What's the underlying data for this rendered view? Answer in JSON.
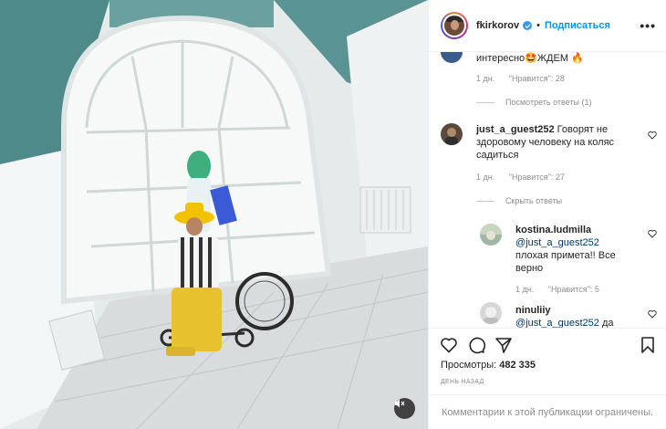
{
  "header": {
    "username": "fkirkorov",
    "dot": "•",
    "follow_label": "Подписаться",
    "more": "•••"
  },
  "comments": [
    {
      "text_end": "интересно🤩ЖДЕМ 🔥",
      "time": "1 дн.",
      "likes": "\"Нравится\": 28",
      "replies": "Посмотреть ответы (1)"
    },
    {
      "username": "just_a_guest252",
      "text_1": "Говорят не",
      "text_2": "здоровому человеку на коляс",
      "text_3": "садиться",
      "time": "1 дн.",
      "likes": "\"Нравится\": 27",
      "replies": "Скрыть ответы"
    }
  ],
  "replies": [
    {
      "username": "kostina.ludmilla",
      "mention": "@just_a_guest252",
      "text_1": "плохая примета!! Все",
      "text_2": "верно",
      "time": "1 дн.",
      "likes": "\"Нравится\": 5"
    },
    {
      "username": "ninuliiy",
      "mention": "@just_a_guest252",
      "text_tail": "да"
    }
  ],
  "stats": {
    "views_label": "Просмотры:",
    "views_count": "482 335",
    "date": "ДЕНЬ НАЗАД"
  },
  "footer": {
    "comments_disabled": "Комментарии к этой публикации ограничены."
  },
  "icons": {
    "like": "heart-icon",
    "comment": "comment-icon",
    "share": "share-icon",
    "save": "bookmark-icon",
    "mute": "speaker-muted-icon"
  },
  "colors": {
    "link_blue": "#0095f6",
    "wall_teal": "#4f8a8b",
    "muted_text": "#8e8e8e"
  }
}
